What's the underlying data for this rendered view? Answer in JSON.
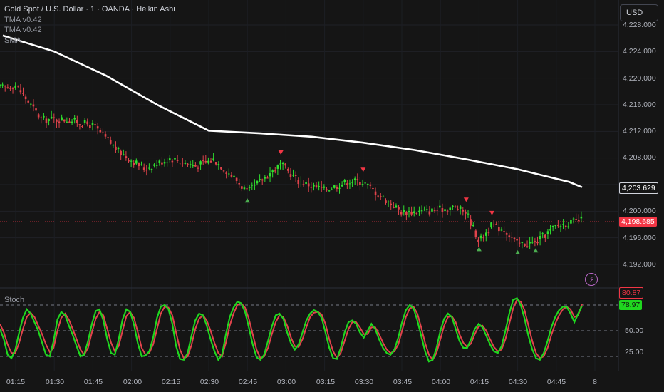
{
  "header": {
    "title": "Gold Spot / U.S. Dollar · 1 · OANDA · Heikin Ashi",
    "indicators": [
      "TMA v0.42",
      "TMA v0.42",
      "SMA"
    ],
    "currency_button": "USD"
  },
  "colors": {
    "background": "#151515",
    "bull": "#2fe02f",
    "bear": "#e0434b",
    "sma": "#ffffff",
    "stoch_k": "#1fd61f",
    "stoch_d": "#e0434b",
    "last_price_badge": "#f23645",
    "signal_buy": "#4caf50",
    "signal_sell": "#f23645"
  },
  "price_axis": {
    "ticks": [
      "4,228.000",
      "4,224.000",
      "4,220.000",
      "4,216.000",
      "4,212.000",
      "4,208.000",
      "4,204.000",
      "4,200.000",
      "4,196.000",
      "4,192.000"
    ],
    "sma_value": "4,203.629",
    "last_price": "4,198.685"
  },
  "stoch_pane": {
    "label": "Stoch",
    "ticks": [
      "50.00",
      "25.00"
    ],
    "k_value": "78.97",
    "d_value": "80.87"
  },
  "time_axis": {
    "ticks": [
      "01:15",
      "01:30",
      "01:45",
      "02:00",
      "02:15",
      "02:30",
      "02:45",
      "03:00",
      "03:15",
      "03:30",
      "03:45",
      "04:00",
      "04:15",
      "04:30",
      "04:45",
      "8"
    ]
  },
  "icons": [
    "lightning-icon"
  ],
  "chart_data": {
    "type": "line",
    "sma_series": {
      "x": [
        "01:10",
        "01:30",
        "01:50",
        "02:10",
        "02:30",
        "02:50",
        "03:10",
        "03:30",
        "03:50",
        "04:10",
        "04:30",
        "04:50",
        "04:55"
      ],
      "y": [
        4226.4,
        4224.0,
        4220.4,
        4216.0,
        4212.1,
        4211.7,
        4211.2,
        4210.3,
        4209.2,
        4207.8,
        4206.3,
        4204.4,
        4203.6
      ]
    },
    "price_path": {
      "x": [
        "01:10",
        "01:15",
        "01:25",
        "01:35",
        "01:45",
        "01:55",
        "02:05",
        "02:15",
        "02:25",
        "02:32",
        "02:40",
        "02:45",
        "02:52",
        "02:58",
        "03:05",
        "03:15",
        "03:25",
        "03:30",
        "03:37",
        "03:45",
        "03:55",
        "04:05",
        "04:10",
        "04:15",
        "04:20",
        "04:25",
        "04:30",
        "04:37",
        "04:45",
        "04:55"
      ],
      "y": [
        4218.6,
        4219.0,
        4213.8,
        4213.8,
        4212.9,
        4209.0,
        4206.4,
        4208.0,
        4206.8,
        4207.8,
        4205.0,
        4202.8,
        4205.2,
        4207.0,
        4204.5,
        4203.2,
        4204.6,
        4204.4,
        4202.2,
        4199.9,
        4200.0,
        4200.6,
        4199.9,
        4195.5,
        4197.9,
        4197.2,
        4195.0,
        4195.3,
        4197.8,
        4198.7
      ]
    },
    "stochastic": {
      "ylim": [
        0,
        100
      ],
      "levels": [
        80,
        50,
        20
      ],
      "k": [
        52,
        40,
        22,
        18,
        28,
        48,
        65,
        75,
        70,
        60,
        50,
        36,
        22,
        20,
        38,
        63,
        72,
        68,
        56,
        45,
        32,
        20,
        22,
        38,
        58,
        73,
        75,
        62,
        40,
        24,
        22,
        40,
        63,
        75,
        72,
        57,
        35,
        20,
        21,
        26,
        42,
        65,
        78,
        80,
        75,
        58,
        32,
        17,
        16,
        24,
        44,
        62,
        70,
        68,
        56,
        40,
        26,
        16,
        22,
        46,
        66,
        77,
        84,
        82,
        72,
        54,
        34,
        19,
        16,
        22,
        38,
        55,
        68,
        70,
        64,
        48,
        35,
        28,
        34,
        48,
        62,
        70,
        74,
        72,
        65,
        48,
        30,
        18,
        17,
        30,
        48,
        60,
        62,
        58,
        48,
        42,
        50,
        58,
        52,
        40,
        30,
        24,
        22,
        28,
        42,
        60,
        74,
        80,
        76,
        62,
        44,
        26,
        14,
        16,
        30,
        50,
        64,
        70,
        66,
        52,
        38,
        30,
        30,
        40,
        52,
        58,
        54,
        44,
        34,
        26,
        24,
        32,
        50,
        70,
        86,
        88,
        80,
        64,
        44,
        28,
        18,
        16,
        24,
        38,
        54,
        66,
        74,
        78,
        78,
        70,
        60,
        70,
        79
      ],
      "d": [
        58,
        48,
        34,
        24,
        24,
        36,
        52,
        66,
        71,
        66,
        56,
        46,
        34,
        25,
        30,
        50,
        65,
        70,
        63,
        52,
        40,
        28,
        22,
        30,
        48,
        64,
        72,
        68,
        52,
        36,
        26,
        32,
        50,
        67,
        72,
        65,
        48,
        30,
        22,
        24,
        34,
        52,
        70,
        78,
        77,
        68,
        48,
        28,
        18,
        20,
        33,
        52,
        64,
        68,
        62,
        50,
        36,
        24,
        20,
        36,
        56,
        70,
        80,
        82,
        77,
        64,
        46,
        28,
        18,
        20,
        30,
        46,
        60,
        68,
        66,
        56,
        42,
        32,
        31,
        40,
        54,
        66,
        71,
        72,
        69,
        58,
        40,
        26,
        18,
        24,
        38,
        52,
        60,
        60,
        54,
        46,
        46,
        54,
        54,
        46,
        36,
        28,
        24,
        26,
        34,
        50,
        66,
        76,
        78,
        70,
        54,
        36,
        22,
        16,
        24,
        40,
        56,
        66,
        67,
        60,
        46,
        36,
        31,
        35,
        46,
        55,
        56,
        50,
        40,
        31,
        26,
        28,
        40,
        58,
        76,
        86,
        84,
        74,
        56,
        38,
        24,
        18,
        20,
        30,
        45,
        58,
        68,
        75,
        78,
        75,
        66,
        68,
        81
      ]
    }
  }
}
